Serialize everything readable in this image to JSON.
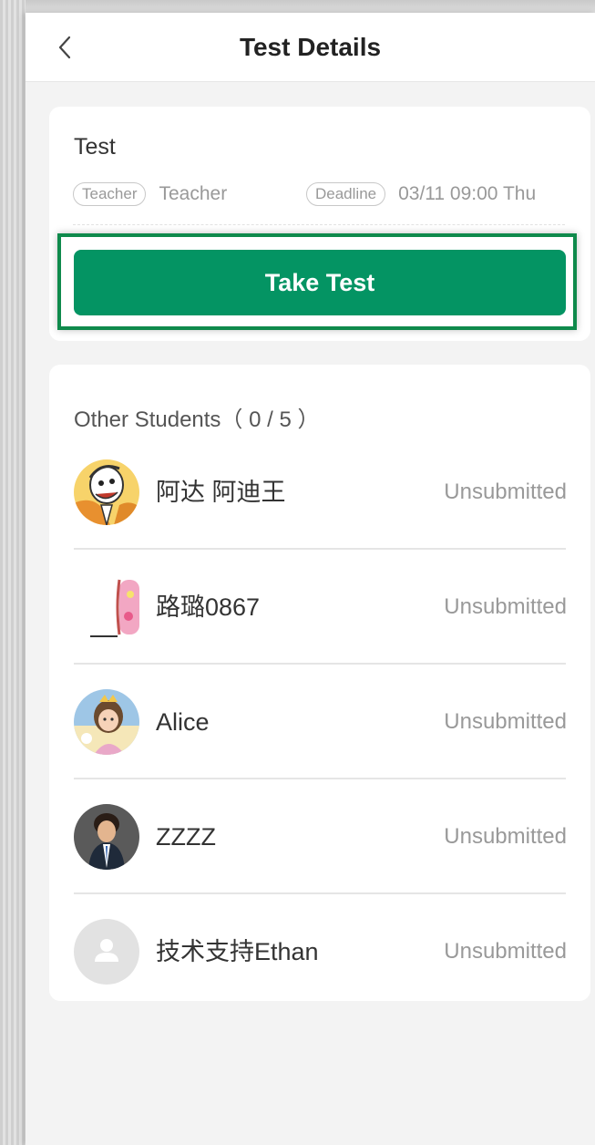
{
  "header": {
    "title": "Test Details",
    "back_icon": "chevron-left-icon"
  },
  "test": {
    "title": "Test",
    "teacher_tag": "Teacher",
    "teacher_name": "Teacher",
    "deadline_tag": "Deadline",
    "deadline_value": "03/11 09:00 Thu",
    "take_test_label": "Take Test"
  },
  "students": {
    "header": "Other Students（ 0 / 5 ）",
    "items": [
      {
        "name": "阿达 阿迪王",
        "status": "Unsubmitted",
        "avatar": "cartoon-avatar"
      },
      {
        "name": "路璐0867",
        "status": "Unsubmitted",
        "avatar": "photo-avatar"
      },
      {
        "name": "Alice",
        "status": "Unsubmitted",
        "avatar": "photo-avatar"
      },
      {
        "name": "ZZZZ",
        "status": "Unsubmitted",
        "avatar": "photo-avatar"
      },
      {
        "name": "技术支持Ethan",
        "status": "Unsubmitted",
        "avatar": "default-user-avatar"
      }
    ]
  },
  "colors": {
    "accent": "#049463",
    "highlight_border": "#0f8a4c",
    "background": "#f3f3f3",
    "card": "#ffffff"
  }
}
